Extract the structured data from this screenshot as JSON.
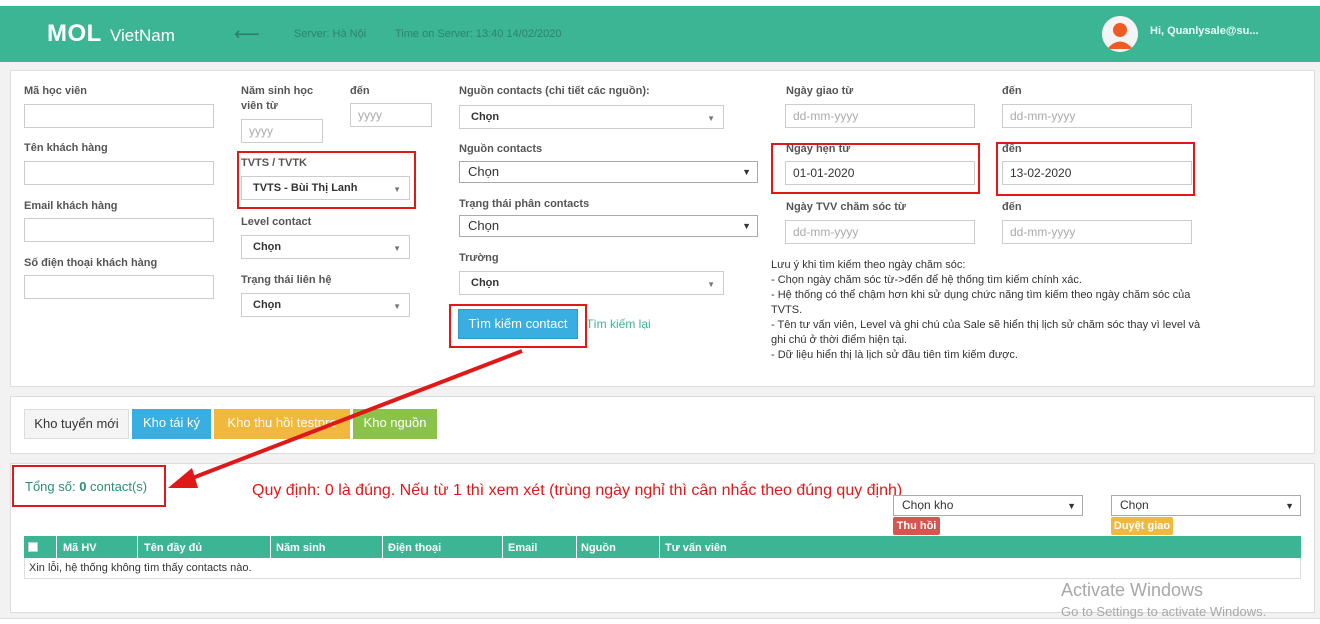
{
  "header": {
    "logo_main": "MOL",
    "logo_sub": "VietNam",
    "back_icon": "left-arrow-icon",
    "server": "Server: Hà Nội",
    "time": "Time on Server: 13:40 14/02/2020",
    "greeting": "Hi, Quanlysale@su..."
  },
  "filters": {
    "ma_hoc_vien": "Mã học viên",
    "ten_khach_hang": "Tên khách hàng",
    "email_khach_hang": "Email khách hàng",
    "so_dien_thoai": "Số điện thoại khách hàng",
    "nam_sinh_tu": "Năm sinh học viên từ",
    "nam_sinh_den": "đến",
    "year_placeholder": "yyyy",
    "tvts_label": "TVTS / TVTK",
    "tvts_value": "TVTS - Bùi Thị Lanh",
    "level_label": "Level contact",
    "level_value": "Chọn",
    "trang_thai_lien_he": "Trạng thái liên hệ",
    "trang_thai_value": "Chọn",
    "nguon_chi_tiet": "Nguồn contacts (chi tiết các nguồn):",
    "nguon_chi_tiet_value": "Chọn",
    "nguon_contacts": "Nguồn contacts",
    "nguon_contacts_value": "Chọn",
    "trang_thai_phan": "Trạng thái phân contacts",
    "trang_thai_phan_value": "Chọn",
    "truong": "Trường",
    "truong_value": "Chọn",
    "search_button": "Tìm kiếm contact",
    "reset_link": "Tìm kiếm lại",
    "ngay_giao_tu": "Ngày giao từ",
    "den": "đến",
    "date_placeholder": "dd-mm-yyyy",
    "ngay_hen_tu": "Ngày hẹn từ",
    "ngay_hen_tu_value": "01-01-2020",
    "ngay_hen_den_value": "13-02-2020",
    "ngay_tvv": "Ngày TVV chăm sóc từ",
    "note_lines": [
      "Lưu ý khi tìm kiếm theo ngày chăm sóc:",
      "- Chọn ngày chăm sóc từ->đến để hệ thống tìm kiếm chính xác.",
      "- Hệ thống có thể chậm hơn khi sử dụng chức năng tìm kiếm theo ngày chăm sóc của TVTS.",
      "- Tên tư vấn viên, Level và ghi chú của Sale sẽ hiển thị lịch sử chăm sóc thay vì level và ghi chú ở thời điểm hiện tại.",
      "- Dữ liệu hiển thị là lịch sử đầu tiên tìm kiếm được."
    ]
  },
  "tabs": {
    "kho_tuyen_moi": "Kho tuyển mới",
    "kho_tai_ky": "Kho tái ký",
    "kho_thu_hoi": "Kho thu hồi testpro",
    "kho_nguon": "Kho nguồn"
  },
  "results": {
    "total_prefix": "Tổng số: ",
    "total_count": "0",
    "total_suffix": " contact(s)",
    "annotation": "Quy định: 0 là đúng. Nếu từ 1 thì xem xét (trùng ngày nghỉ thì cân nhắc theo đúng quy định)",
    "chon_kho": "Chọn kho",
    "chon": "Chọn",
    "thu_hoi": "Thu hồi",
    "duyet_giao": "Duyệt giao",
    "columns": [
      "Mã HV",
      "Tên đầy đủ",
      "Năm sinh",
      "Điện thoại",
      "Email",
      "Nguồn",
      "Tư vấn viên"
    ],
    "empty_message": "Xin lỗi, hệ thống không tìm thấy contacts nào."
  },
  "watermark": {
    "title": "Activate Windows",
    "subtitle": "Go to Settings to activate Windows."
  },
  "colors": {
    "brand": "#3bb594",
    "primary_button": "#3aaee0",
    "warning": "#f0b83c",
    "success": "#8bc34a",
    "danger": "#d9534f",
    "annotation_red": "#e01818"
  }
}
